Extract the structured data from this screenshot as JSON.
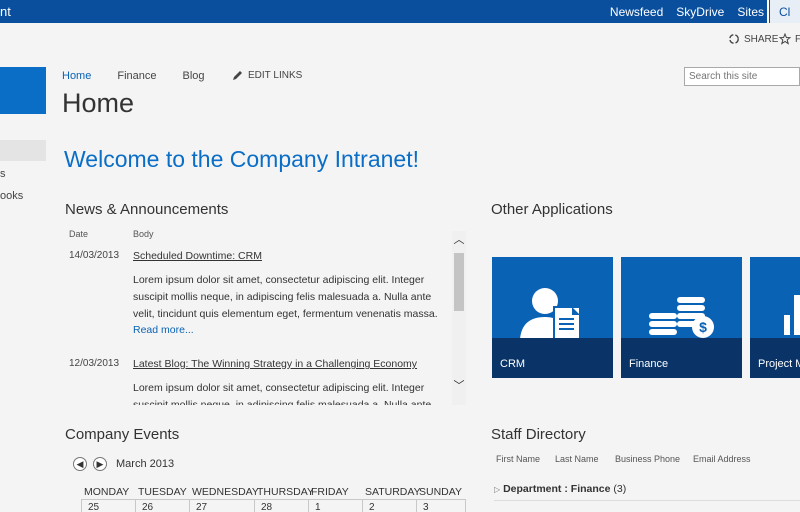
{
  "suite": {
    "brand": "nt",
    "links": [
      "Newsfeed",
      "SkyDrive",
      "Sites"
    ],
    "active_tab": "Cl",
    "color": "#0a4f9e"
  },
  "ribbon": {
    "share": "SHARE",
    "follow": "F"
  },
  "leftnav": {
    "item_a": "s",
    "item_b": "ooks"
  },
  "topnav": {
    "items": [
      "Home",
      "Finance",
      "Blog"
    ],
    "edit_links": "EDIT LINKS"
  },
  "search": {
    "placeholder": "Search this site"
  },
  "page_title": "Home",
  "welcome": "Welcome to the Company Intranet!",
  "news": {
    "title": "News & Announcements",
    "col_date": "Date",
    "col_body": "Body",
    "items": [
      {
        "date": "14/03/2013",
        "title": "Scheduled Downtime: CRM",
        "lines": [
          "Lorem ipsum dolor sit amet, consectetur adipiscing elit. Integer",
          "suscipit mollis neque, in adipiscing felis malesuada a. Nulla ante",
          "velit, tincidunt quis elementum eget, fermentum venenatis massa."
        ],
        "read_more": "Read more..."
      },
      {
        "date": "12/03/2013",
        "title": "Latest Blog: The Winning Strategy in a Challenging Economy",
        "lines": [
          "Lorem ipsum dolor sit amet, consectetur adipiscing elit. Integer",
          "suscipit mollis neque, in adipiscing felis malesuada a. Nulla ante"
        ]
      }
    ]
  },
  "apps": {
    "title": "Other Applications",
    "tiles": [
      {
        "label": "CRM",
        "icon": "person-document-icon"
      },
      {
        "label": "Finance",
        "icon": "coins-dollar-icon"
      },
      {
        "label": "Project M",
        "icon": "chart-icon"
      }
    ],
    "tile_color": "#0a62b5",
    "band_color": "#0a3468"
  },
  "events": {
    "title": "Company Events",
    "month": "March 2013",
    "days": [
      "MONDAY",
      "TUESDAY",
      "WEDNESDAY",
      "THURSDAY",
      "FRIDAY",
      "SATURDAY",
      "SUNDAY"
    ],
    "dates": [
      "25",
      "26",
      "27",
      "28",
      "1",
      "2",
      "3"
    ]
  },
  "staff": {
    "title": "Staff Directory",
    "columns": [
      "First Name",
      "Last Name",
      "Business Phone",
      "Email Address"
    ],
    "group_label": "Department",
    "group_value": "Finance",
    "group_count": "(3)"
  }
}
